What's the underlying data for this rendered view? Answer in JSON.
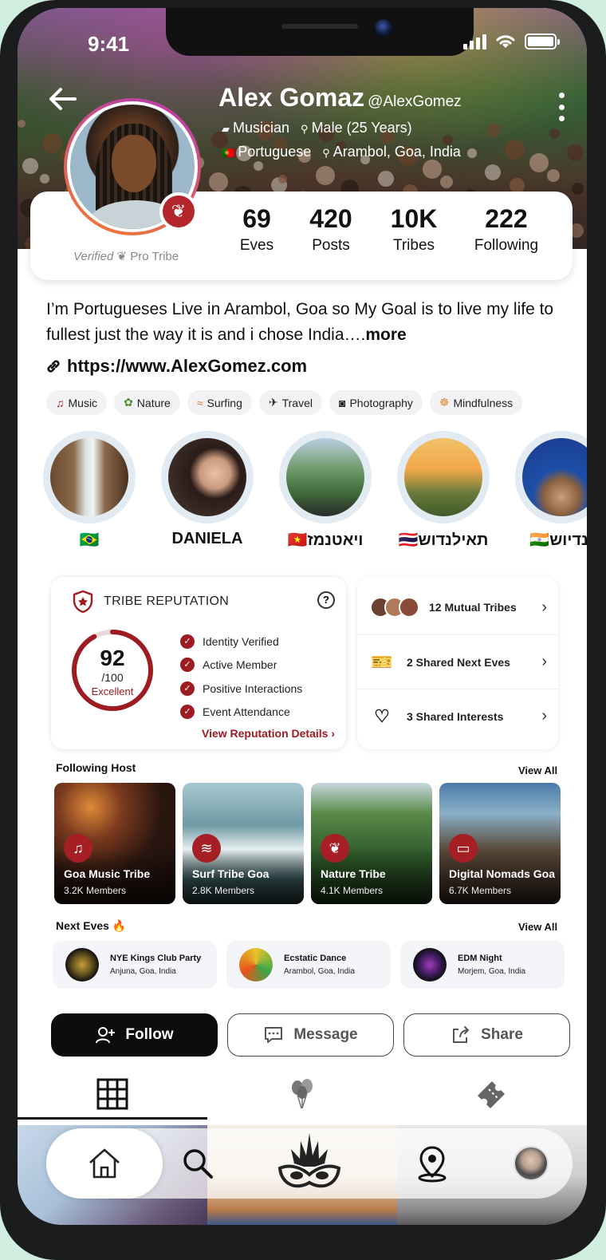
{
  "status_bar": {
    "time": "9:41"
  },
  "profile": {
    "name": "Alex Gomaz",
    "handle": "@AlexGomez",
    "role": "Musician",
    "gender_age": "Male (25 Years)",
    "language": "Portuguese",
    "location": "Arambol, Goa, India",
    "verified_label": "Verified",
    "pro_label": "Pro Tribe",
    "bio": "I’m Portugueses Live in Arambol, Goa so My Goal is to live my life to fullest just the way it is and i chose India….",
    "bio_more": "more",
    "website": "https://www.AlexGomez.com"
  },
  "stats": [
    {
      "value": "69",
      "label": "Eves"
    },
    {
      "value": "420",
      "label": "Posts"
    },
    {
      "value": "10K",
      "label": "Tribes"
    },
    {
      "value": "222",
      "label": "Following"
    }
  ],
  "interests": [
    {
      "icon": "music-icon",
      "label": "Music"
    },
    {
      "icon": "nature-icon",
      "label": "Nature"
    },
    {
      "icon": "surfing-icon",
      "label": "Surfing"
    },
    {
      "icon": "plane-icon",
      "label": "Travel"
    },
    {
      "icon": "camera-icon",
      "label": "Photography"
    },
    {
      "icon": "meditation-icon",
      "label": "Mindfulness"
    }
  ],
  "stories": [
    {
      "label": "🇧🇷"
    },
    {
      "label": "DANIELA"
    },
    {
      "label": "🇻🇳ויאטנמז"
    },
    {
      "label": "🇹🇭תאילנדוש"
    },
    {
      "label": "🇮🇳ינדיוש"
    }
  ],
  "reputation": {
    "title": "TRIBE REPUTATION",
    "help": "?",
    "score": "92",
    "score_out_of": "/100",
    "score_value": 0.92,
    "rating": "Excellent",
    "checks": [
      "Identity Verified",
      "Active Member",
      "Positive Interactions",
      "Event Attendance"
    ],
    "link": "View Reputation Details",
    "accent_color": "#9d1c22"
  },
  "mutual": [
    {
      "label": "12 Mutual Tribes"
    },
    {
      "label": "2 Shared Next Eves"
    },
    {
      "label": "3 Shared Interests"
    }
  ],
  "following_host": {
    "title": "Following Host",
    "view_all": "View All",
    "items": [
      {
        "name": "Goa Music Tribe",
        "members": "3.2K Members",
        "icon": "music-note-icon"
      },
      {
        "name": "Surf Tribe Goa",
        "members": "2.8K Members",
        "icon": "wave-icon"
      },
      {
        "name": "Nature Tribe",
        "members": "4.1K Members",
        "icon": "lotus-icon"
      },
      {
        "name": "Digital Nomads Goa",
        "members": "6.7K Members",
        "icon": "laptop-icon"
      }
    ]
  },
  "next_eves": {
    "title": "Next Eves",
    "view_all": "View All",
    "items": [
      {
        "name": "NYE Kings Club Party",
        "location": "Anjuna, Goa, India"
      },
      {
        "name": "Ecstatic Dance",
        "location": "Arambol, Goa, India"
      },
      {
        "name": "EDM Night",
        "location": "Morjem, Goa, India"
      }
    ]
  },
  "actions": {
    "follow": "Follow",
    "message": "Message",
    "share": "Share"
  },
  "tabs": [
    "grid-icon",
    "balloons-icon",
    "ticket-icon"
  ],
  "bottom_nav": [
    "home-icon",
    "search-icon",
    "tribe-mask-icon",
    "location-pin-icon",
    "avatar-icon"
  ]
}
